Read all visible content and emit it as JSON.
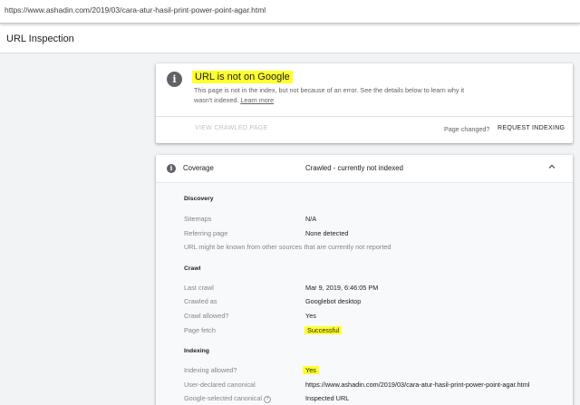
{
  "browser": {
    "url": "https://www.ashadin.com/2019/03/cara-atur-hasil-print-power-point-agar.html"
  },
  "header": {
    "title": "URL Inspection"
  },
  "status_card": {
    "title": "URL is not on Google",
    "description": "This page is not in the index, but not because of an error. See the details below to learn why it wasn't indexed.",
    "learn_more": "Learn more",
    "view_crawled": "VIEW CRAWLED PAGE",
    "page_changed": "Page changed?",
    "request_indexing": "REQUEST INDEXING"
  },
  "coverage": {
    "label": "Coverage",
    "value": "Crawled - currently not indexed",
    "discovery": {
      "heading": "Discovery",
      "sitemaps_label": "Sitemaps",
      "sitemaps_value": "N/A",
      "referring_label": "Referring page",
      "referring_value": "None detected",
      "note": "URL might be known from other sources that are currently not reported"
    },
    "crawl": {
      "heading": "Crawl",
      "last_crawl_label": "Last crawl",
      "last_crawl_value": "Mar 9, 2019, 6:46:05 PM",
      "crawled_as_label": "Crawled as",
      "crawled_as_value": "Googlebot desktop",
      "crawl_allowed_label": "Crawl allowed?",
      "crawl_allowed_value": "Yes",
      "page_fetch_label": "Page fetch",
      "page_fetch_value": "Successful"
    },
    "indexing": {
      "heading": "Indexing",
      "indexing_allowed_label": "Indexing allowed?",
      "indexing_allowed_value": "Yes",
      "user_canonical_label": "User-declared canonical",
      "user_canonical_value": "https://www.ashadin.com/2019/03/cara-atur-hasil-print-power-point-agar.html",
      "google_canonical_label": "Google-selected canonical",
      "google_canonical_value": "Inspected URL"
    }
  },
  "icons": {
    "info": "info-icon",
    "chevron": "chevron-up-icon",
    "help": "help-icon"
  },
  "colors": {
    "highlight": "#ffff2e",
    "background": "#f1f3f4"
  }
}
